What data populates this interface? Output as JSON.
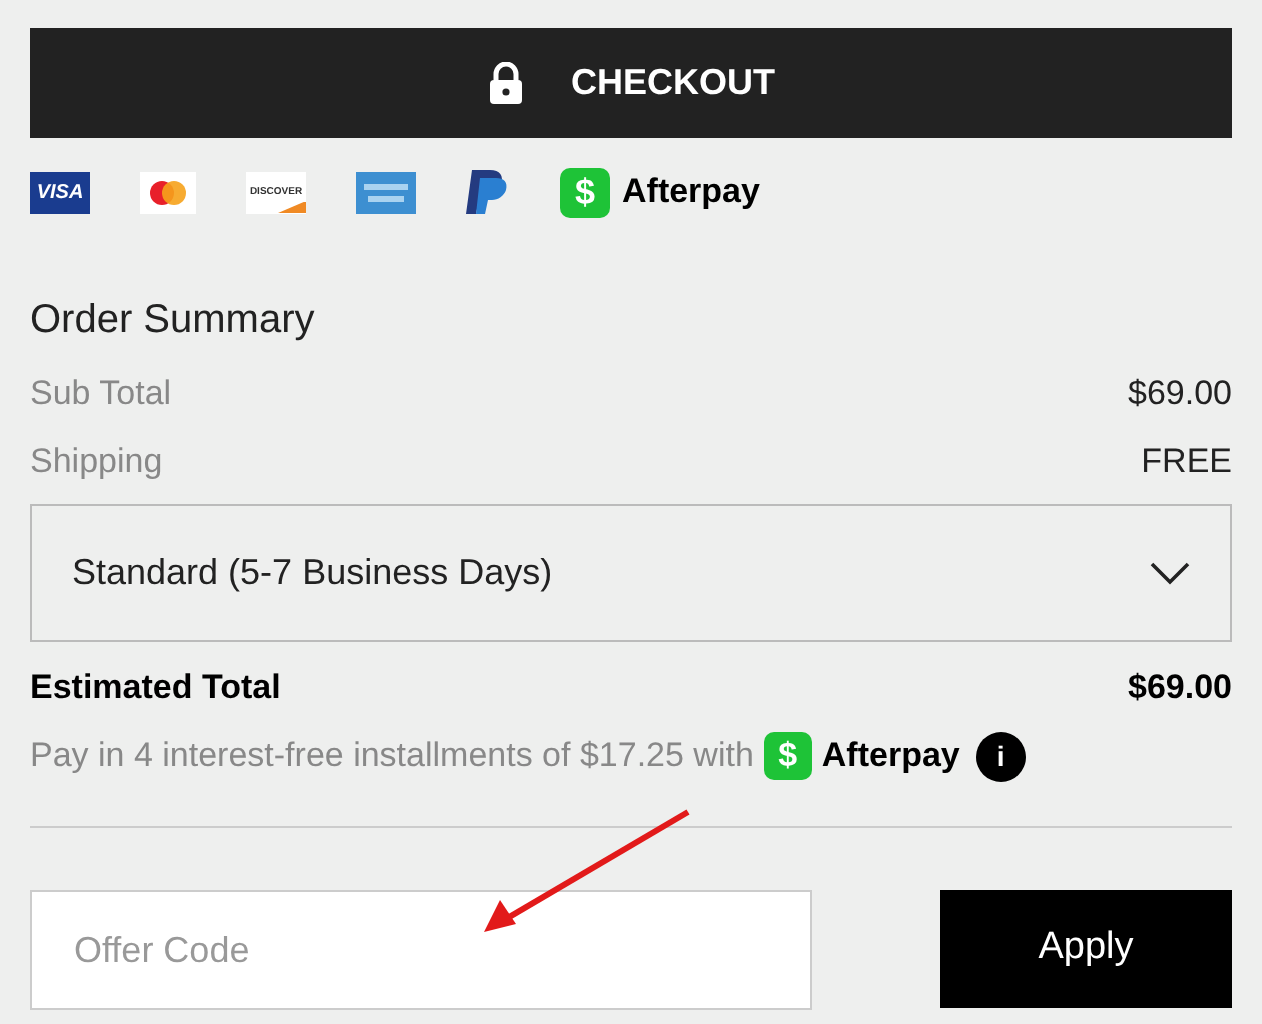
{
  "checkout_button": {
    "label": "CHECKOUT"
  },
  "payment_methods": [
    {
      "kind": "visa",
      "label": "VISA"
    },
    {
      "kind": "mastercard"
    },
    {
      "kind": "discover",
      "label": "DISCOVER"
    },
    {
      "kind": "amex"
    },
    {
      "kind": "paypal"
    },
    {
      "kind": "afterpay",
      "icon_text": "$",
      "label": "Afterpay"
    }
  ],
  "order_summary": {
    "title": "Order Summary",
    "rows": [
      {
        "label": "Sub Total",
        "value": "$69.00"
      },
      {
        "label": "Shipping",
        "value": "FREE"
      }
    ],
    "shipping_select": {
      "value": "Standard (5-7 Business Days)"
    },
    "total": {
      "label": "Estimated Total",
      "value": "$69.00"
    },
    "installments": {
      "text": "Pay in 4 interest-free installments of $17.25 with",
      "icon_text": "$",
      "brand": "Afterpay",
      "info_icon_text": "i"
    }
  },
  "offer_code": {
    "placeholder": "Offer Code",
    "button": "Apply"
  }
}
